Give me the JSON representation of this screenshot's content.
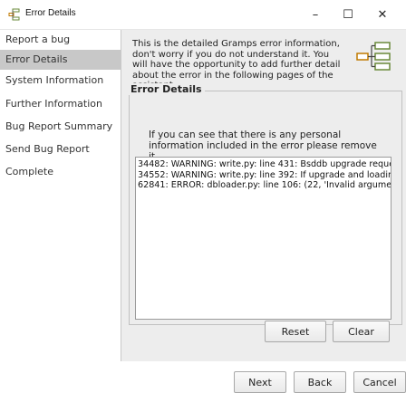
{
  "window": {
    "title": "Error Details",
    "minimize": "–",
    "maximize": "☐",
    "close": "✕"
  },
  "sidebar": {
    "items": [
      {
        "label": "Report a bug"
      },
      {
        "label": "Error Details"
      },
      {
        "label": "System Information"
      },
      {
        "label": "Further Information"
      },
      {
        "label": "Bug Report Summary"
      },
      {
        "label": "Send Bug Report"
      },
      {
        "label": "Complete"
      }
    ],
    "active_index": 1
  },
  "main": {
    "intro": "This is the detailed Gramps error information, don't worry if you do not understand it. You will have the opportunity to add further detail about the error in the following pages of the assistant.",
    "frame_label": "Error Details",
    "notice": "If you can see that there is any personal information included in the error please remove it.",
    "log_lines": [
      "34482: WARNING: write.py: line 431: Bsddb upgrade reque",
      "34552: WARNING: write.py: line 392: If upgrade and loading",
      "62841: ERROR: dbloader.py: line 106: (22, 'Invalid argumer"
    ],
    "reset_label": "Reset",
    "clear_label": "Clear"
  },
  "footer": {
    "next_label": "Next",
    "back_label": "Back",
    "cancel_label": "Cancel"
  }
}
